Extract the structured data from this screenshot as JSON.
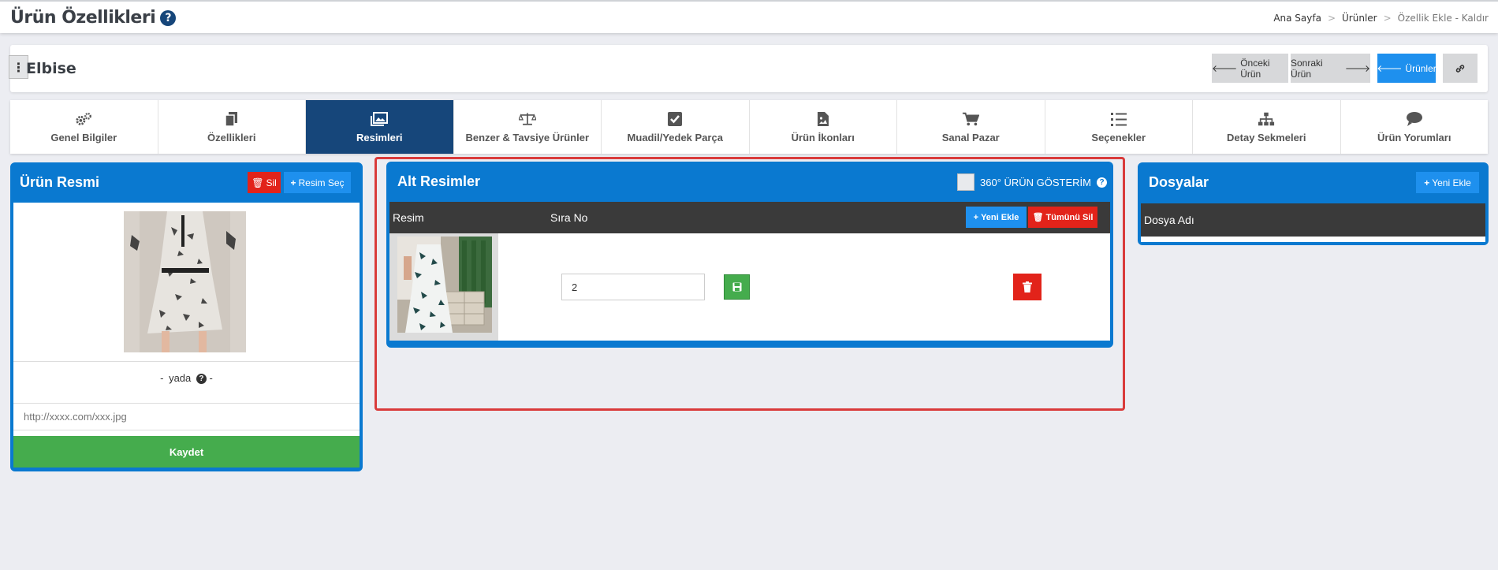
{
  "header": {
    "title": "Ürün Özellikleri",
    "help": "?",
    "breadcrumb": [
      "Ana Sayfa",
      "Ürünler",
      "Özellik Ekle - Kaldır"
    ],
    "breadcrumb_sep": ">"
  },
  "product": {
    "menu": "⋮",
    "name": "Elbise",
    "prev": "Önceki Ürün",
    "next": "Sonraki Ürün",
    "products": "Ürünler"
  },
  "tabs": [
    {
      "label": "Genel Bilgiler",
      "icon": "gears-icon"
    },
    {
      "label": "Özellikleri",
      "icon": "copy-icon"
    },
    {
      "label": "Resimleri",
      "icon": "images-icon"
    },
    {
      "label": "Benzer & Tavsiye Ürünler",
      "icon": "balance-scale-icon"
    },
    {
      "label": "Muadil/Yedek Parça",
      "icon": "check-square-icon"
    },
    {
      "label": "Ürün İkonları",
      "icon": "file-image-icon"
    },
    {
      "label": "Sanal Pazar",
      "icon": "cart-icon"
    },
    {
      "label": "Seçenekler",
      "icon": "list-icon"
    },
    {
      "label": "Detay Sekmeleri",
      "icon": "sitemap-icon"
    },
    {
      "label": "Ürün Yorumları",
      "icon": "comment-icon"
    }
  ],
  "active_tab": "Resimleri",
  "main_image": {
    "title": "Ürün Resmi",
    "delete": "Sil",
    "choose": "Resim Seç",
    "or_dash_left": "-",
    "or": "yada",
    "or_dash_right": "-",
    "url_placeholder": "http://xxxx.com/xxx.jpg",
    "save": "Kaydet"
  },
  "sub_images": {
    "title": "Alt Resimler",
    "show360": "360° ÜRÜN GÖSTERİM",
    "columns": [
      "Resim",
      "Sıra No"
    ],
    "add": "Yeni Ekle",
    "delete_all": "Tümünü Sil",
    "rows": [
      {
        "order": "2"
      }
    ]
  },
  "files": {
    "title": "Dosyalar",
    "add": "Yeni Ekle",
    "column": "Dosya Adı"
  },
  "colors": {
    "primary": "#0a79d0",
    "active_tab": "#16467a",
    "danger": "#e2231a",
    "success": "#45ac4d",
    "button_blue": "#1e90ee"
  }
}
